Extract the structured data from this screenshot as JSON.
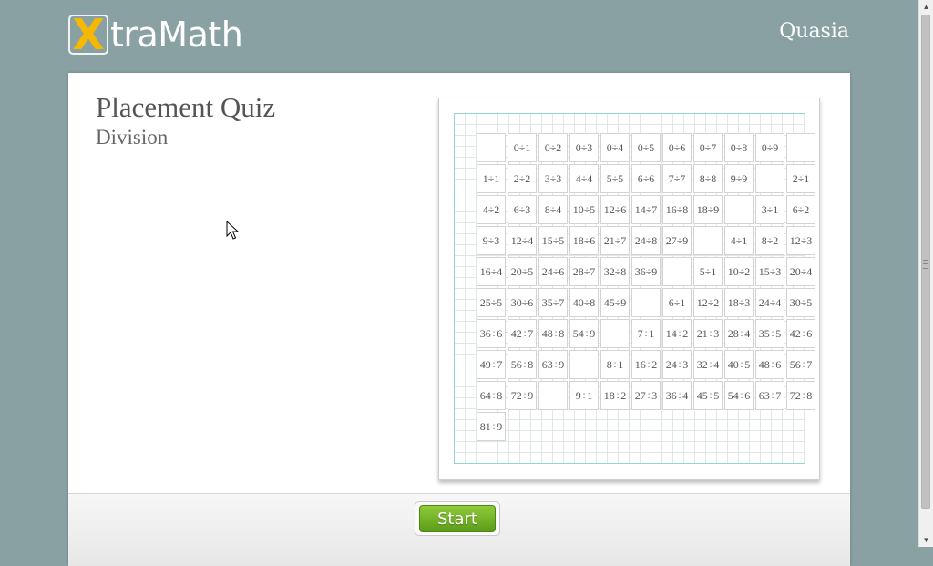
{
  "header": {
    "logo_x": "X",
    "logo_rest": "traMath",
    "username": "Quasia"
  },
  "quiz": {
    "title": "Placement Quiz",
    "subtitle": "Division"
  },
  "facts_grid": [
    [
      "",
      "0÷1",
      "0÷2",
      "0÷3",
      "0÷4",
      "0÷5",
      "0÷6",
      "0÷7",
      "0÷8",
      "0÷9"
    ],
    [
      "",
      "1÷1",
      "2÷2",
      "3÷3",
      "4÷4",
      "5÷5",
      "6÷6",
      "7÷7",
      "8÷8",
      "9÷9"
    ],
    [
      "",
      "2÷1",
      "4÷2",
      "6÷3",
      "8÷4",
      "10÷5",
      "12÷6",
      "14÷7",
      "16÷8",
      "18÷9"
    ],
    [
      "",
      "3÷1",
      "6÷2",
      "9÷3",
      "12÷4",
      "15÷5",
      "18÷6",
      "21÷7",
      "24÷8",
      "27÷9"
    ],
    [
      "",
      "4÷1",
      "8÷2",
      "12÷3",
      "16÷4",
      "20÷5",
      "24÷6",
      "28÷7",
      "32÷8",
      "36÷9"
    ],
    [
      "",
      "5÷1",
      "10÷2",
      "15÷3",
      "20÷4",
      "25÷5",
      "30÷6",
      "35÷7",
      "40÷8",
      "45÷9"
    ],
    [
      "",
      "6÷1",
      "12÷2",
      "18÷3",
      "24÷4",
      "30÷5",
      "36÷6",
      "42÷7",
      "48÷8",
      "54÷9"
    ],
    [
      "",
      "7÷1",
      "14÷2",
      "21÷3",
      "28÷4",
      "35÷5",
      "42÷6",
      "49÷7",
      "56÷8",
      "63÷9"
    ],
    [
      "",
      "8÷1",
      "16÷2",
      "24÷3",
      "32÷4",
      "40÷5",
      "48÷6",
      "56÷7",
      "64÷8",
      "72÷9"
    ],
    [
      "",
      "9÷1",
      "18÷2",
      "27÷3",
      "36÷4",
      "45÷5",
      "54÷6",
      "63÷7",
      "72÷8",
      "81÷9"
    ]
  ],
  "footer": {
    "start_label": "Start"
  },
  "colors": {
    "background": "#89a1a3",
    "logo_accent": "#f6b800",
    "start_button": "#6fae22",
    "grid_border": "#93d6d1"
  },
  "icons": {
    "scroll_up": "triangle-up",
    "scroll_down": "triangle-down",
    "cursor": "arrow-pointer"
  }
}
